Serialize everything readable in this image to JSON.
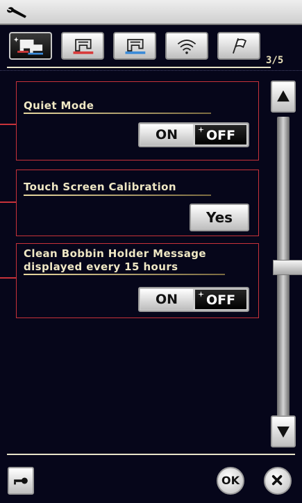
{
  "header": {
    "icon": "wrench-icon"
  },
  "tabs": [
    {
      "icon": "machine-settings-icon",
      "active": true
    },
    {
      "icon": "sewing-settings-icon",
      "active": false
    },
    {
      "icon": "embroidery-settings-icon",
      "active": false
    },
    {
      "icon": "wireless-icon",
      "active": false
    },
    {
      "icon": "flag-icon",
      "active": false
    }
  ],
  "page_indicator": "3/5",
  "settings": [
    {
      "title": "Quiet Mode",
      "control": "toggle",
      "on_label": "ON",
      "off_label": "OFF",
      "selected": "OFF"
    },
    {
      "title": "Touch Screen Calibration",
      "control": "button",
      "button_label": "Yes"
    },
    {
      "title_line1": "Clean Bobbin Holder Message",
      "title_line2": "displayed every 15 hours",
      "control": "toggle",
      "on_label": "ON",
      "off_label": "OFF",
      "selected": "OFF"
    }
  ],
  "scroll": {
    "up_icon": "arrow-up-icon",
    "down_icon": "arrow-down-icon",
    "position": 0.5
  },
  "footer": {
    "key_icon": "key-icon",
    "ok_label": "OK",
    "close_icon": "close-icon"
  },
  "colors": {
    "background": "#06061a",
    "panel_border": "#c8323a",
    "label_text": "#efe7c4"
  }
}
